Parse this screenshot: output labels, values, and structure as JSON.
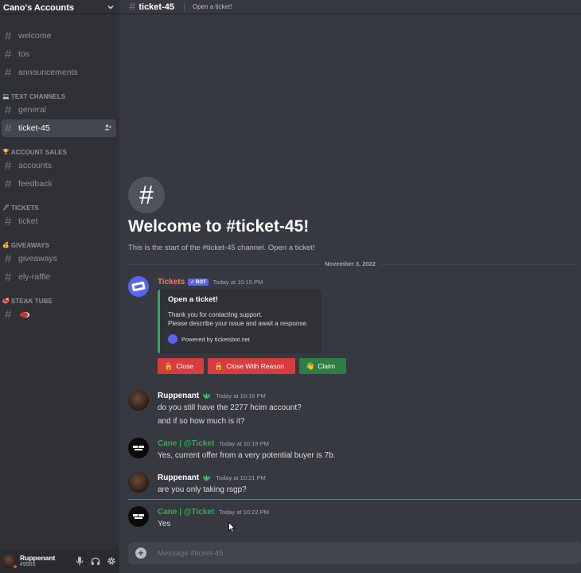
{
  "server": {
    "name": "Cano's Accounts"
  },
  "sidebar": {
    "top_channels": [
      "welcome",
      "tos",
      "announcements"
    ],
    "categories": [
      {
        "name": "TEXT CHANNELS",
        "emoji": "💻",
        "channels": [
          "general",
          "ticket-45"
        ]
      },
      {
        "name": "ACCOUNT SALES",
        "emoji": "🏆",
        "channels": [
          "accounts",
          "feedback"
        ]
      },
      {
        "name": "TICKETS",
        "emoji": "🖊",
        "channels": [
          "ticket"
        ]
      },
      {
        "name": "GIVEAWAYS",
        "emoji": "💰",
        "channels": [
          "giveaways",
          "ely-raffle"
        ]
      },
      {
        "name": "STEAK TUBE",
        "emoji": "🥩",
        "channels": [
          ""
        ]
      }
    ],
    "active_channel": "ticket-45"
  },
  "user": {
    "name": "Ruppenant",
    "tag": "#9565",
    "status_color": "#ed4245"
  },
  "topbar": {
    "channel": "ticket-45",
    "topic": "Open a ticket!"
  },
  "welcome": {
    "title": "Welcome to #ticket-45!",
    "subtitle": "This is the start of the #ticket-45 channel. Open a ticket!"
  },
  "date_divider": "November 3, 2022",
  "messages": {
    "tickets": {
      "author": "Tickets",
      "bot_tag": "✓ BOT",
      "time": "Today at 10:15 PM",
      "embed": {
        "title": "Open a ticket!",
        "line1": "Thank you for contacting support.",
        "line2": "Please describe your issue and await a response.",
        "footer": "Powered by ticketsbot.net"
      },
      "buttons": {
        "close": "Close",
        "close_reason": "Close With Reason",
        "claim": "Claim"
      }
    },
    "rupp1": {
      "author": "Ruppenant",
      "time": "Today at 10:15 PM",
      "line1": "do you still have the 2277 hcim account?",
      "line2": "and if so how much is it?"
    },
    "cane1": {
      "author": "Cane | @Ticket",
      "time": "Today at 10:19 PM",
      "line1": "Yes, current offer from a very potential buyer is 7b."
    },
    "rupp2": {
      "author": "Ruppenant",
      "time": "Today at 10:21 PM",
      "line1": "are you only taking rsgp?"
    },
    "cane2": {
      "author": "Cane | @Ticket",
      "time": "Today at 10:22 PM",
      "line1": "Yes"
    }
  },
  "composer": {
    "placeholder": "Message #ticket-45"
  },
  "colors": {
    "accent": "#5865f2",
    "embed_bar": "#3ba55d",
    "danger": "#d83c3e",
    "success": "#2d7d46",
    "cane_name": "#3ba55d",
    "tickets_name": "#f47b67"
  }
}
